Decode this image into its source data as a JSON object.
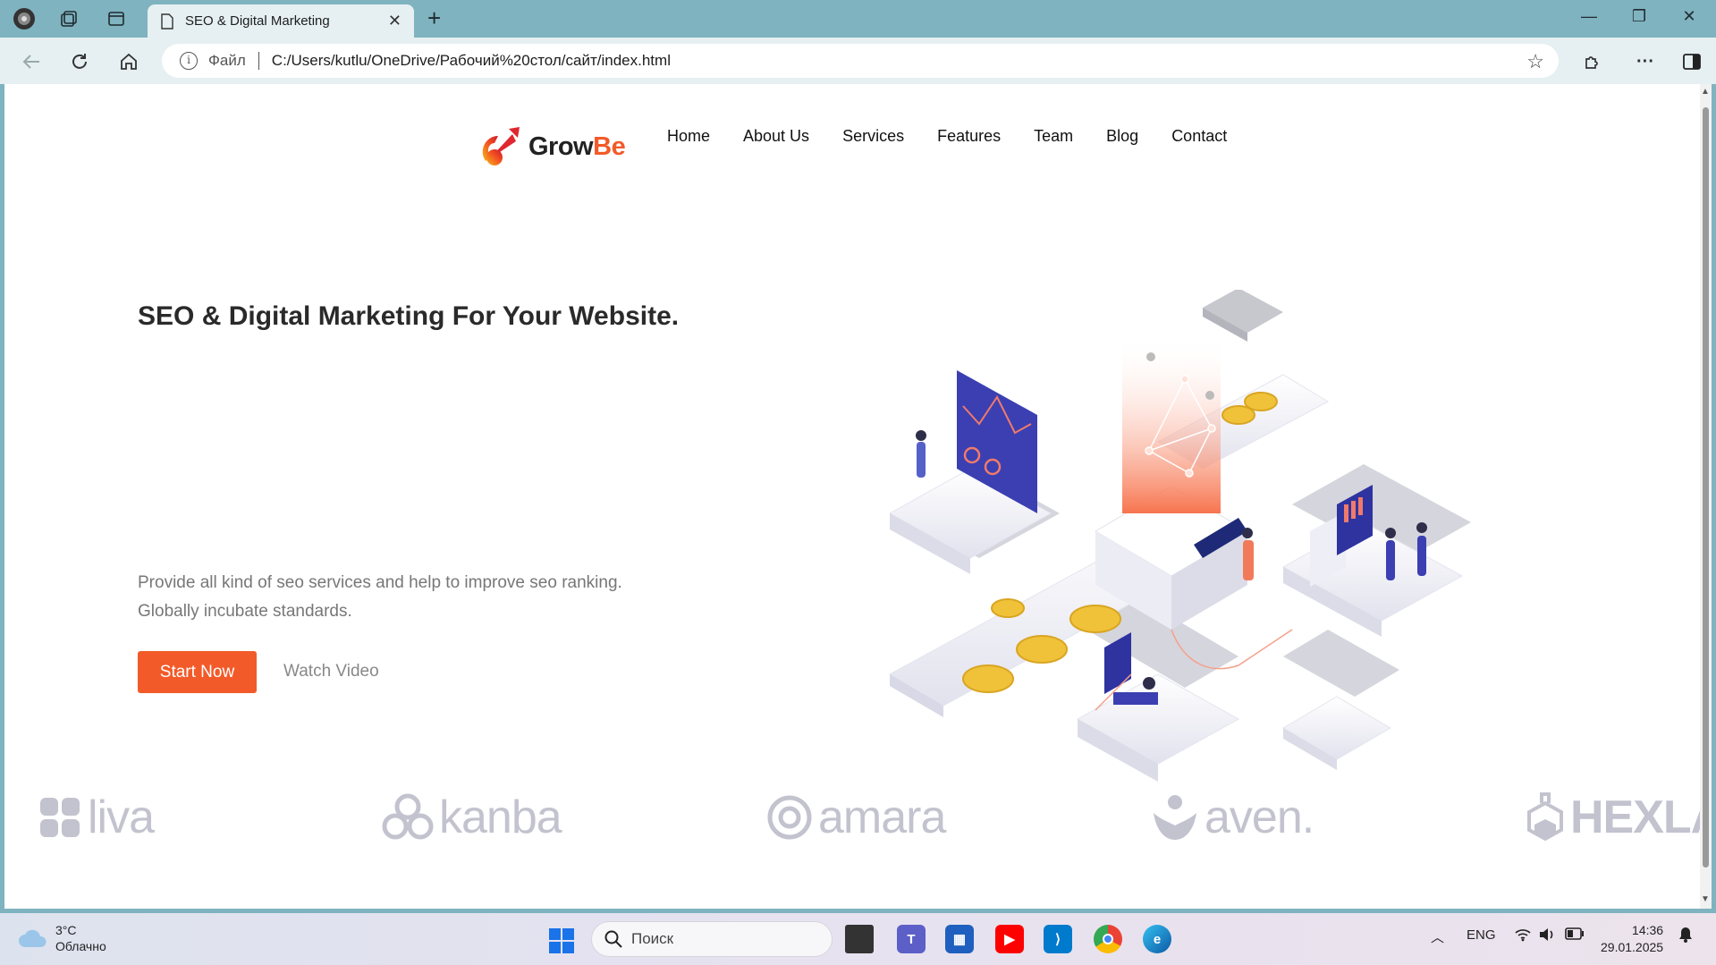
{
  "browser": {
    "tab_title": "SEO & Digital Marketing",
    "address_scheme": "Файл",
    "address_url": "C:/Users/kutlu/OneDrive/Рабочий%20стол/сайт/index.html"
  },
  "site": {
    "logo_main": "Grow",
    "logo_accent": "Be",
    "nav": [
      "Home",
      "About Us",
      "Services",
      "Features",
      "Team",
      "Blog",
      "Contact"
    ],
    "hero": {
      "title": "SEO & Digital Marketing For Your Website.",
      "description_line1": "Provide all kind of seo services and help to improve seo ranking.",
      "description_line2": "Globally incubate standards.",
      "primary_button": "Start Now",
      "secondary_link": "Watch Video"
    },
    "brands": [
      "liva",
      "kanba",
      "amara",
      "aven.",
      "HEXLAB"
    ]
  },
  "taskbar": {
    "weather_temp": "3°C",
    "weather_desc": "Облачно",
    "search_placeholder": "Поиск",
    "language": "ENG",
    "time": "14:36",
    "date": "29.01.2025"
  },
  "colors": {
    "accent": "#f25a29",
    "chrome": "#7fb3bf",
    "brand_gray": "#c3c3cf"
  }
}
